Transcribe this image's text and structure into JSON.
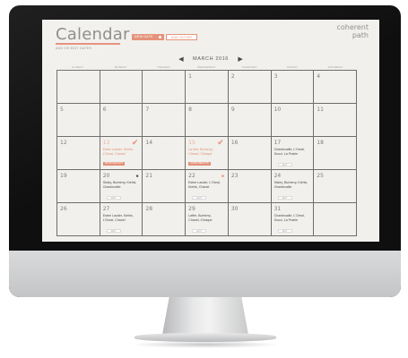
{
  "app": {
    "title": "Calendar",
    "sub_nav": "ADD OR EDIT  DATES"
  },
  "toolbar": {
    "new_label": "NEW DATE",
    "outer_label": "ADD OUTER"
  },
  "brand": {
    "line1": "coherent",
    "line2": "path"
  },
  "nav": {
    "month": "MARCH 2016",
    "prev_icon": "chevron-left-icon",
    "next_icon": "chevron-right-icon"
  },
  "weekdays": [
    "SUNDAY",
    "MONDAY",
    "TUESDAY",
    "WEDNESDAY",
    "THURSDAY",
    "FRIDAY",
    "SATURDAY"
  ],
  "colors": {
    "accent": "#e48f76",
    "screen_bg": "#f1f0ec",
    "grid_line": "#6d6d6d"
  },
  "cells": [
    {
      "day": ""
    },
    {
      "day": ""
    },
    {
      "day": ""
    },
    {
      "day": "1"
    },
    {
      "day": "2"
    },
    {
      "day": "3"
    },
    {
      "day": "4"
    },
    {
      "day": "5"
    },
    {
      "day": "6"
    },
    {
      "day": "7"
    },
    {
      "day": "8"
    },
    {
      "day": "9"
    },
    {
      "day": "10"
    },
    {
      "day": "11"
    },
    {
      "day": "12"
    },
    {
      "day": "13",
      "accent": true,
      "icon": "check-icon",
      "brands": "Estee Lauder, Kiehls, L'Oreal, Chanel",
      "tag": "SHOW RESULTS"
    },
    {
      "day": "14"
    },
    {
      "day": "15",
      "accent": true,
      "icon": "check-icon",
      "brands": "La Mer, Burberry, Chanel, Clinique",
      "tag": "SHOW RESULTS"
    },
    {
      "day": "16"
    },
    {
      "day": "17",
      "brands": "Chantecaille, L'Oreal, Gucci, La Prairie",
      "pill": "EDIT"
    },
    {
      "day": "18"
    },
    {
      "day": "19"
    },
    {
      "day": "20",
      "icon": "lock-icon",
      "brands": "Sisley, Burberry, Kiehls, Chantecaille",
      "pill": "EDIT"
    },
    {
      "day": "21"
    },
    {
      "day": "22",
      "icon": "lock-icon",
      "icon_accent": true,
      "brands": "Estee Lauder, L'Oreal, Kiehls, Chanel",
      "pill": "EDIT"
    },
    {
      "day": "23"
    },
    {
      "day": "24",
      "brands": "Sisley, Burberry, Kiehls, Chantecaille",
      "pill": "EDIT"
    },
    {
      "day": "25"
    },
    {
      "day": "26"
    },
    {
      "day": "27",
      "brands": "Estee Lauder, Kiehls, L'Oreal, Chanel",
      "pill": "EDIT"
    },
    {
      "day": "28"
    },
    {
      "day": "29",
      "brands": "Laffer, Burberry, Chanel, Clinique",
      "pill": "EDIT"
    },
    {
      "day": "30"
    },
    {
      "day": "31",
      "brands": "Chantecaille, L'Oreal, Gucci, La Prairie",
      "pill": "EDIT"
    },
    {
      "day": ""
    }
  ]
}
